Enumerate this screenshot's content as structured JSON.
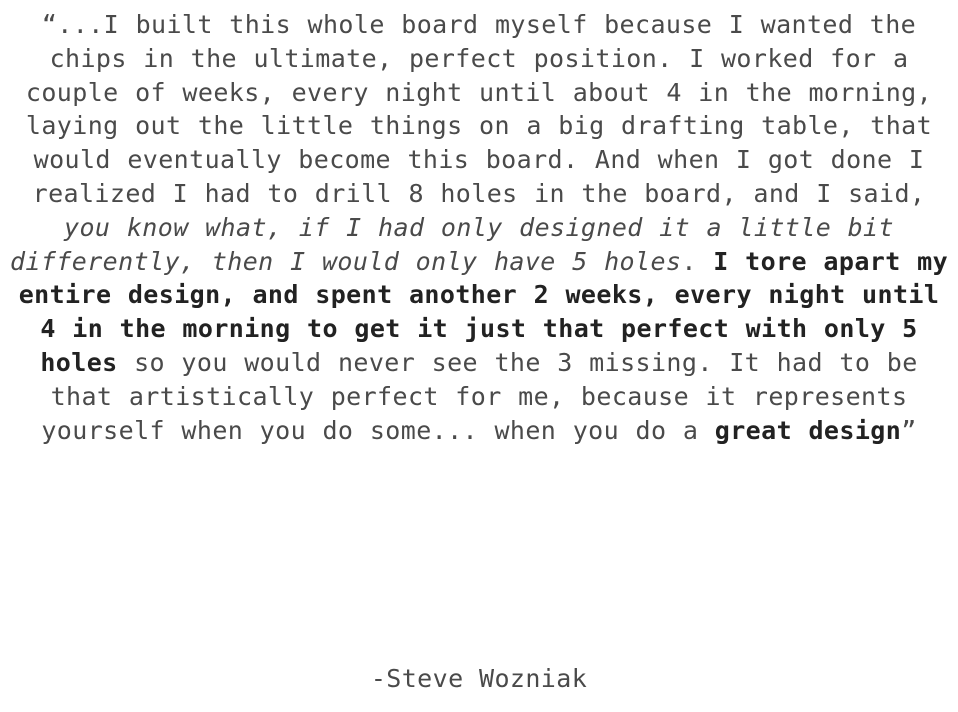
{
  "quote": {
    "part1": "“...I built this whole board myself because I wanted the chips in the ultimate, perfect position. I worked for a couple of weeks, every night until about 4 in the morning, laying out the little things on a big drafting table, that would eventually become this board. And when I got done I realized I had to drill 8 holes in the board, and I said, ",
    "italic": "you know what, if I had only designed it a little bit differently, then I would only have 5 holes",
    "part2": ". ",
    "bold1": "I tore apart my entire design, and spent another 2 weeks, every night until 4 in the morning to get it just that perfect with only 5 holes",
    "part3": " so you would never see the 3 missing. It had to be that artistically perfect for me, because it represents yourself when you do some... when you do a ",
    "bold2": "great design",
    "closing": "”"
  },
  "attribution": "-Steve Wozniak"
}
